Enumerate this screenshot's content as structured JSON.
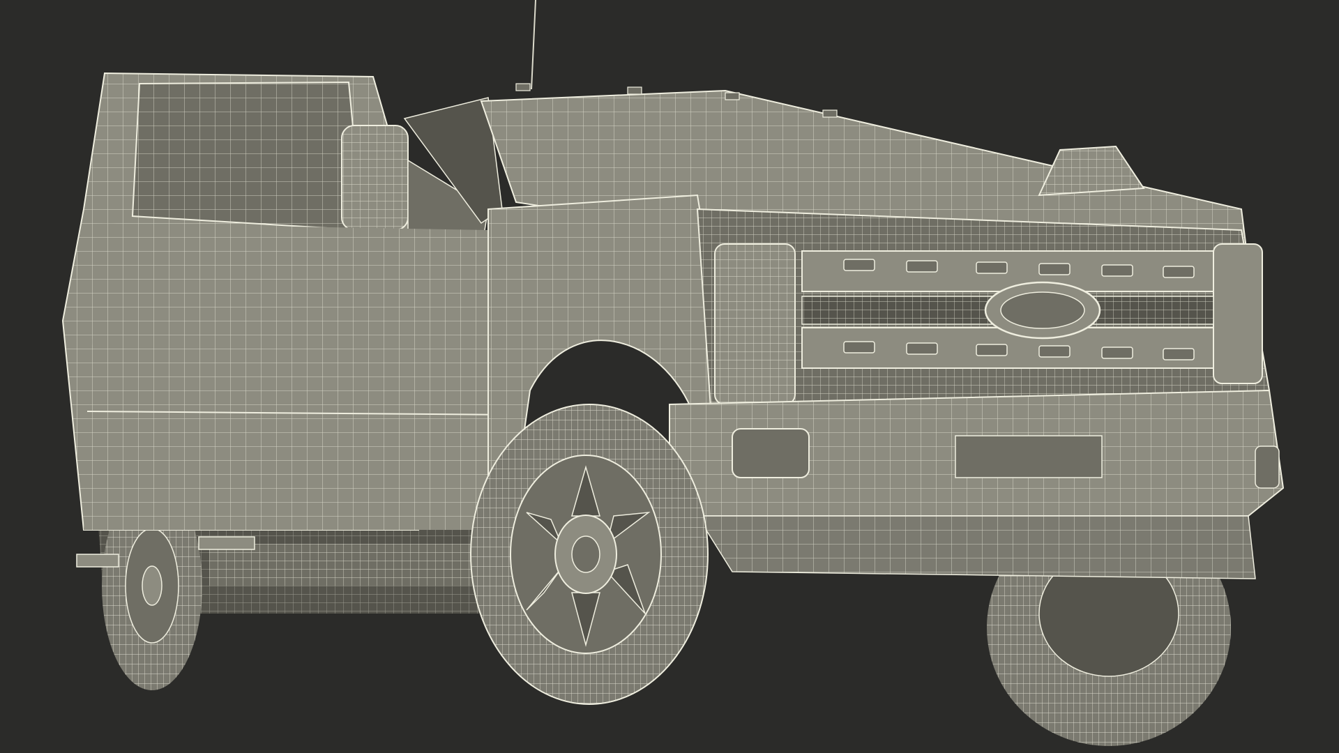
{
  "scene": {
    "subject": "pickup-truck-wireframe",
    "colors": {
      "background": "#2b2b29",
      "surface": "#8d8c80",
      "surface_dark": "#6f6e64",
      "surface_shadow": "#55544c",
      "wire": "#efeedf",
      "tire": "#7b7a70"
    }
  }
}
